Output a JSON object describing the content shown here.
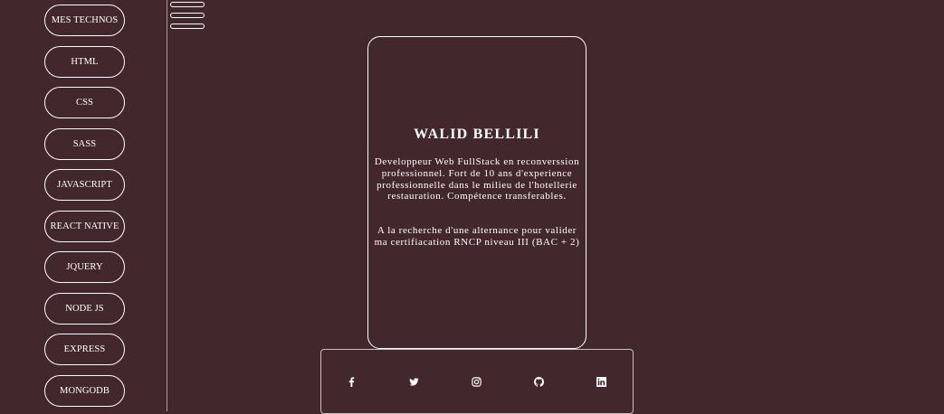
{
  "sidebar": {
    "items": [
      {
        "label": "MES TECHNOS"
      },
      {
        "label": "HTML"
      },
      {
        "label": "CSS"
      },
      {
        "label": "SASS"
      },
      {
        "label": "JAVASCRIPT"
      },
      {
        "label": "REACT NATIVE"
      },
      {
        "label": "JQUERY"
      },
      {
        "label": "NODE JS"
      },
      {
        "label": "EXPRESS"
      },
      {
        "label": "MONGODB"
      }
    ]
  },
  "menu": {
    "icon": "hamburger-menu-icon"
  },
  "profile": {
    "name": "WALID BELLILI",
    "bio": "Developpeur Web FullStack en reconverssion professionnel. Fort de 10 ans d'experience professionnelle dans le milieu de l'hotellerie restauration. Compétence transferables.",
    "goal": "A la recherche d'une alternance pour valider ma certifiacation RNCP niveau III (BAC + 2)"
  },
  "social": {
    "links": [
      {
        "name": "facebook",
        "icon": "facebook-icon"
      },
      {
        "name": "twitter",
        "icon": "twitter-icon"
      },
      {
        "name": "instagram",
        "icon": "instagram-icon"
      },
      {
        "name": "github",
        "icon": "github-icon"
      },
      {
        "name": "linkedin",
        "icon": "linkedin-icon"
      }
    ]
  },
  "colors": {
    "background": "#42282d",
    "foreground": "#ffffff",
    "divider": "#a9979a"
  }
}
